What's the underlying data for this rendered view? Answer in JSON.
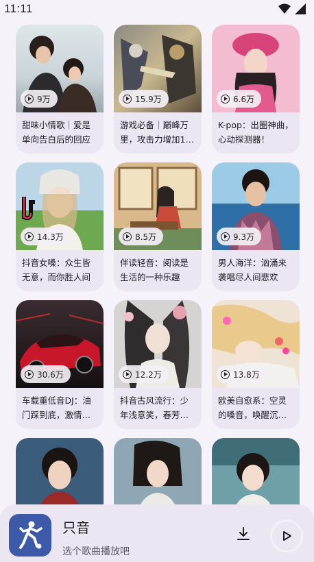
{
  "status": {
    "time": "11:11"
  },
  "cards": [
    {
      "title": "甜味小情歌｜爱是单向告白后的回应",
      "plays": "9万"
    },
    {
      "title": "游戏必备｜巅峰万里，攻击力增加1…",
      "plays": "15.9万"
    },
    {
      "title": "K-pop：出圈神曲，心动探测器！",
      "plays": "6.6万"
    },
    {
      "title": "抖音女嗓：众生皆无意，而你胜人间",
      "plays": "14.3万"
    },
    {
      "title": "伴读轻音：阅读是生活的一种乐趣",
      "plays": "8.5万"
    },
    {
      "title": "男人海洋：汹涌来袭唱尽人间悲欢",
      "plays": "9.3万"
    },
    {
      "title": "车载重低音DJ：油门踩到底，激情…",
      "plays": "30.6万"
    },
    {
      "title": "抖音古风流行：少年浅意笑，春芳…",
      "plays": "12.2万"
    },
    {
      "title": "欧美自愈系：空灵的嗓音，唤醒沉…",
      "plays": "13.8万"
    },
    {
      "title": "",
      "plays": ""
    },
    {
      "title": "",
      "plays": ""
    },
    {
      "title": "",
      "plays": ""
    }
  ],
  "player": {
    "title": "只音",
    "subtitle": "选个歌曲播放吧",
    "download_icon": "download-icon",
    "play_icon": "play-icon"
  },
  "colors": {
    "background": "#f6f2fa",
    "card": "#ece6f2",
    "avatar": "#3d5aa8"
  }
}
